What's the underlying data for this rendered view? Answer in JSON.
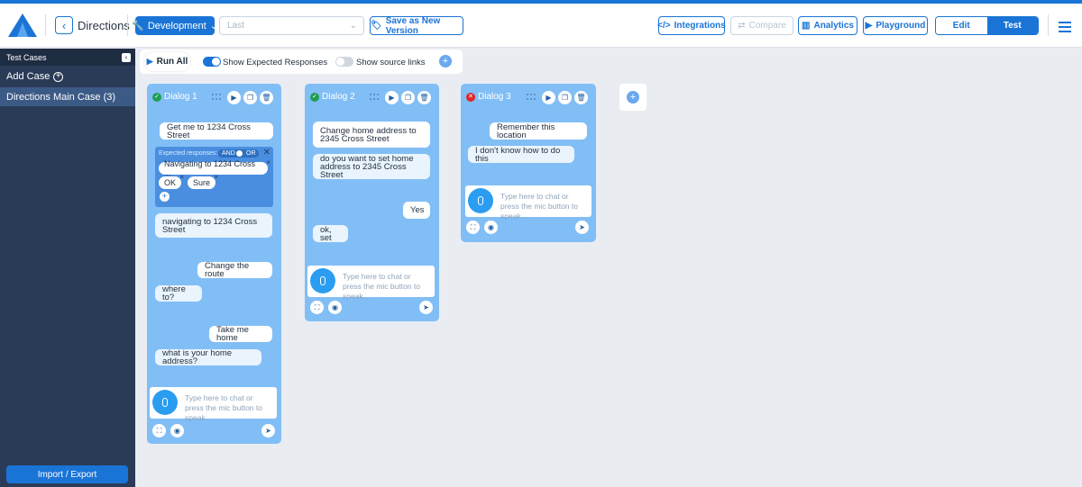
{
  "header": {
    "title": "Directions",
    "dev_button": "Development",
    "version_placeholder": "Last",
    "save_version": "Save as New Version",
    "integrations": "Integrations",
    "compare": "Compare",
    "analytics": "Analytics",
    "playground": "Playground",
    "edit_tab": "Edit",
    "test_tab": "Test"
  },
  "sidebar": {
    "heading": "Test Cases",
    "add_case": "Add Case",
    "items": [
      {
        "label": "Directions Main Case (3)"
      }
    ],
    "import_export": "Import / Export"
  },
  "toolbar": {
    "run_all": "Run All",
    "show_expected": "Show Expected Responses",
    "show_expected_on": true,
    "show_source": "Show source links",
    "show_source_on": false
  },
  "dialogs": [
    {
      "title": "Dialog 1",
      "status": "passed",
      "user_1": "Get me to 1234 Cross Street",
      "expected_label": "Expected responses:",
      "and_label": "AND",
      "or_label": "OR",
      "chips": [
        "Navigating to 1234 Cross ...",
        "OK",
        "Sure"
      ],
      "bot_1": "navigating to 1234 Cross Street",
      "user_2": "Change the route",
      "bot_2": "where to?",
      "user_3": "Take me home",
      "bot_3": "what is your home address?",
      "input_placeholder": "Type here to chat or press the mic button to speak..."
    },
    {
      "title": "Dialog 2",
      "status": "passed",
      "user_1": "Change home address to 2345 Cross Street",
      "bot_1": "do you want to set home address to 2345 Cross Street",
      "user_2": "Yes",
      "bot_2": "ok, set",
      "input_placeholder": "Type here to chat or press the mic button to speak..."
    },
    {
      "title": "Dialog 3",
      "status": "failed",
      "user_1": "Remember this location",
      "bot_1": "I don't know how to do this",
      "input_placeholder": "Type here to chat or press the mic button to speak..."
    }
  ],
  "colors": {
    "accent": "#1a74d6",
    "dialog_bg": "#82bef6",
    "sidebar_bg": "#2a3b57"
  }
}
